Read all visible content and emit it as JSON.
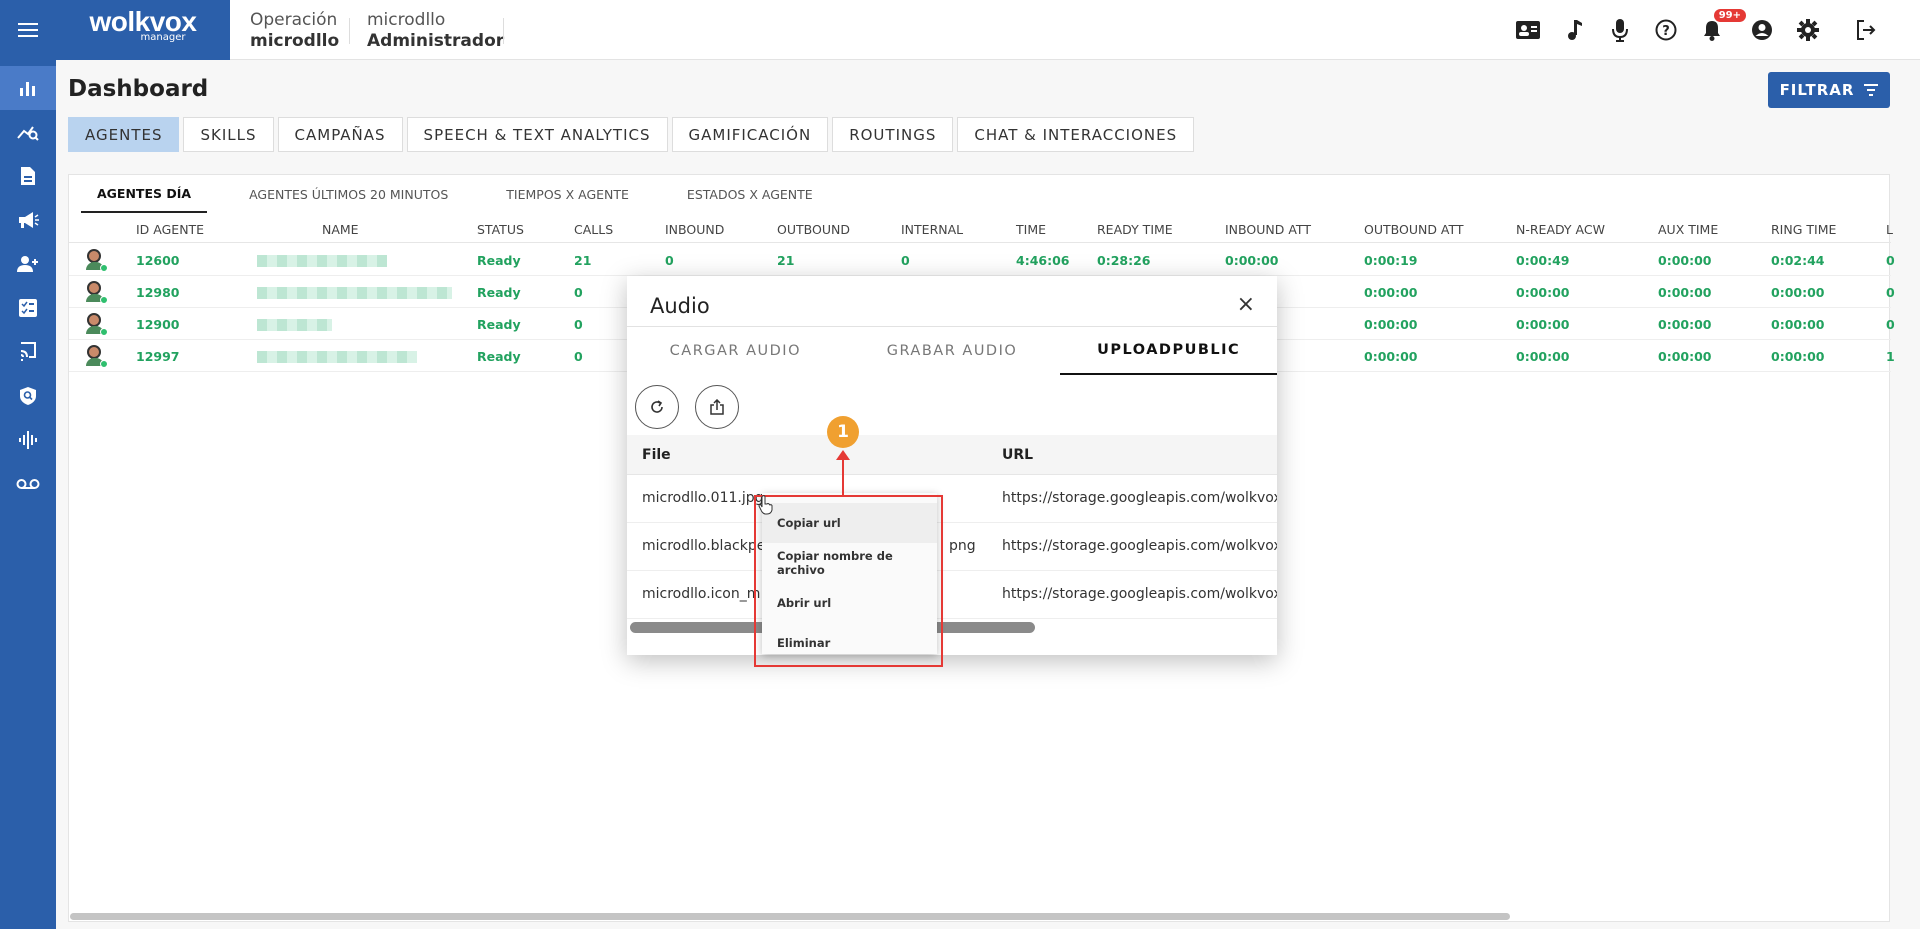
{
  "app": {
    "logo_main": "wolkvox",
    "logo_sub": "manager"
  },
  "header": {
    "operation_label": "Operación",
    "operation_value": "microdllo",
    "user_label": "microdllo",
    "user_role": "Administrador",
    "notifications_badge": "99+"
  },
  "page": {
    "title": "Dashboard",
    "filter_label": "FILTRAR"
  },
  "tabs": [
    "AGENTES",
    "SKILLS",
    "CAMPAÑAS",
    "SPEECH & TEXT ANALYTICS",
    "GAMIFICACIÓN",
    "ROUTINGS",
    "CHAT & INTERACCIONES"
  ],
  "subtabs": [
    "AGENTES DÍA",
    "AGENTES ÚLTIMOS 20 MINUTOS",
    "TIEMPOS X AGENTE",
    "ESTADOS X AGENTE"
  ],
  "table": {
    "columns": [
      "ID AGENTE",
      "NAME",
      "STATUS",
      "CALLS",
      "INBOUND",
      "OUTBOUND",
      "INTERNAL",
      "TIME",
      "READY TIME",
      "INBOUND ATT",
      "OUTBOUND ATT",
      "N-READY ACW",
      "AUX TIME",
      "RING TIME",
      "L"
    ],
    "rows": [
      {
        "id": "12600",
        "status": "Ready",
        "calls": "21",
        "inbound": "0",
        "outbound": "21",
        "internal": "0",
        "time": "4:46:06",
        "ready_time": "0:28:26",
        "inbound_att": "0:00:00",
        "outbound_att": "0:00:19",
        "nready_acw": "0:00:49",
        "aux_time": "0:00:00",
        "ring_time": "0:02:44",
        "last": "0"
      },
      {
        "id": "12980",
        "status": "Ready",
        "calls": "0",
        "outbound_att": "0:00:00",
        "nready_acw": "0:00:00",
        "aux_time": "0:00:00",
        "ring_time": "0:00:00",
        "last": "0"
      },
      {
        "id": "12900",
        "status": "Ready",
        "calls": "0",
        "outbound_att": "0:00:00",
        "nready_acw": "0:00:00",
        "aux_time": "0:00:00",
        "ring_time": "0:00:00",
        "last": "0"
      },
      {
        "id": "12997",
        "status": "Ready",
        "calls": "0",
        "outbound_att": "0:00:00",
        "nready_acw": "0:00:00",
        "aux_time": "0:00:00",
        "ring_time": "0:00:00",
        "last": "1"
      }
    ]
  },
  "modal": {
    "title": "Audio",
    "close": "×",
    "tabs": [
      "CARGAR AUDIO",
      "GRABAR AUDIO",
      "UPLOADPUBLIC"
    ],
    "columns": [
      "File",
      "URL"
    ],
    "files": [
      {
        "name": "microdllo.011.jpg",
        "url": "https://storage.googleapis.com/wolkvox-c"
      },
      {
        "name": "microdllo.blackpe",
        "name_tail": "png",
        "url": "https://storage.googleapis.com/wolkvox-c"
      },
      {
        "name": "microdllo.icon_m",
        "url": "https://storage.googleapis.com/wolkvox-c"
      }
    ]
  },
  "context_menu": [
    "Copiar url",
    "Copiar nombre de archivo",
    "Abrir url",
    "Eliminar"
  ],
  "annotation": {
    "step": "1"
  },
  "colors": {
    "brand": "#2b5faa",
    "status_green": "#22a25f",
    "highlight_red": "#e53935",
    "step_orange": "#f0a030"
  }
}
